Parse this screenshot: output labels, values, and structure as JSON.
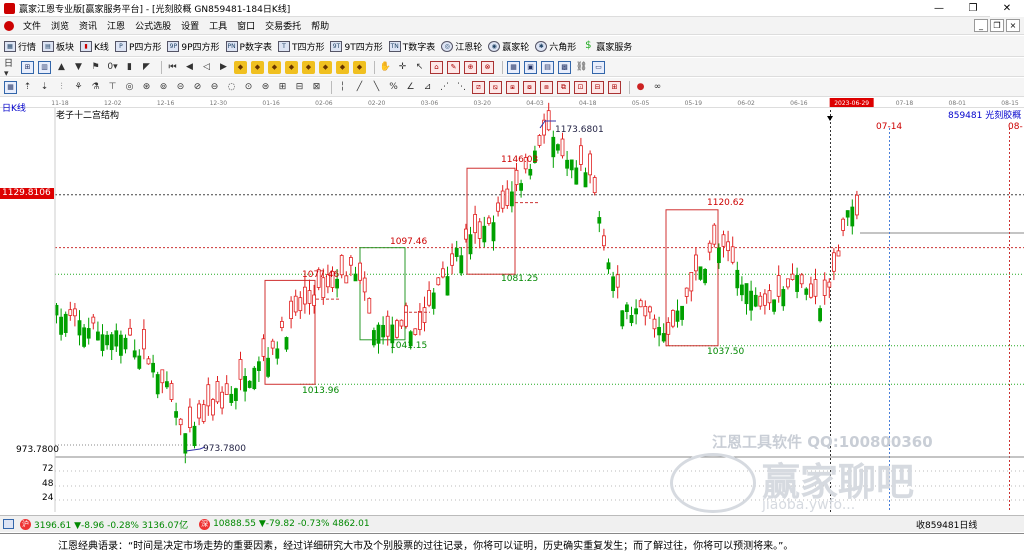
{
  "window": {
    "title": "赢家江恩专业版[赢家服务平台] - [光刻胶概  GN859481-184日K线]"
  },
  "menu": [
    "文件",
    "浏览",
    "资讯",
    "江恩",
    "公式选股",
    "设置",
    "工具",
    "窗口",
    "交易委托",
    "帮助"
  ],
  "toolbar1": [
    {
      "icon": "quote-icon",
      "label": "行情"
    },
    {
      "icon": "block-icon",
      "label": "板块"
    },
    {
      "icon": "kline-icon",
      "label": "K线"
    },
    {
      "icon": "p-square-icon",
      "label": "P四方形"
    },
    {
      "icon": "9p-square-icon",
      "label": "9P四方形"
    },
    {
      "icon": "p-number-table-icon",
      "label": "P数字表"
    },
    {
      "icon": "t-square-icon",
      "label": "T四方形"
    },
    {
      "icon": "9t-square-icon",
      "label": "9T四方形"
    },
    {
      "icon": "t-number-table-icon",
      "label": "T数字表"
    },
    {
      "icon": "gann-wheel-icon",
      "label": "江恩轮"
    },
    {
      "icon": "winner-wheel-icon",
      "label": "赢家轮"
    },
    {
      "icon": "hexagon-icon",
      "label": "六角形"
    },
    {
      "icon": "dollar-icon",
      "label": "赢家服务"
    }
  ],
  "chart": {
    "period_label": "日K线",
    "study_label": "老子十二宫结构",
    "code_label": "859481  光刻胶概",
    "right_edge_label": "08-",
    "date_axis": [
      "11-18",
      "12-02",
      "12-16",
      "12-30",
      "01-16",
      "02-06",
      "02-20",
      "03-06",
      "03-20",
      "04-03",
      "04-18",
      "05-05",
      "05-19",
      "06-02",
      "06-16",
      "2023-06-29",
      "07-18",
      "08-01",
      "08-15"
    ],
    "future_date": "07-14",
    "last_price_tag": "1129.8106",
    "low_axis_label": "973.7800",
    "volume_ticks": [
      "72",
      "48",
      "24"
    ],
    "annotations": {
      "high": "1173.6801",
      "low": "973.7800",
      "b1_top": "1077.46",
      "b1_bottom": "1013.96",
      "b2_top": "1097.46",
      "b2_bottom": "1041.15",
      "b3_top": "1146.03",
      "b3_bottom": "1081.25",
      "b4_top": "1120.62",
      "b4_bottom": "1037.50"
    }
  },
  "watermark": {
    "line1": "江恩工具软件  QQ:100800360",
    "big": "赢家聊吧",
    "site": "jiaoba.ywfo..."
  },
  "status": {
    "sh": "3196.61 ▼-8.96 -0.28% 3136.07亿",
    "sz": "10888.55 ▼-79.82 -0.73% 4862.01",
    "right": "收859481日线"
  },
  "quote": "江恩经典语录：“时间是决定市场走势的重要因素，经过详细研究大市及个别股票的过往记录，你将可以证明，历史确实重复发生；而了解过往，你将可以预测将来。”。",
  "colors": {
    "up": "#e02020",
    "down": "#00a000",
    "box_red": "#d03030",
    "box_green": "#2a9a2a",
    "price_tag": "#d00000"
  }
}
